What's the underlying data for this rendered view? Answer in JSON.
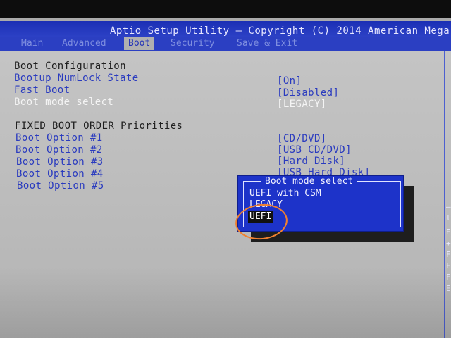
{
  "title": "Aptio Setup Utility – Copyright (C) 2014 American Mega",
  "tabs": [
    {
      "label": "Main"
    },
    {
      "label": "Advanced"
    },
    {
      "label": "Boot"
    },
    {
      "label": "Security"
    },
    {
      "label": "Save & Exit"
    }
  ],
  "boot_config": {
    "heading": "Boot Configuration",
    "items": [
      {
        "label": "Bootup NumLock State",
        "value": "[On]"
      },
      {
        "label": "Fast Boot",
        "value": "[Disabled]"
      },
      {
        "label": "Boot mode select",
        "value": "[LEGACY]"
      }
    ]
  },
  "boot_order": {
    "heading": "FIXED BOOT ORDER Priorities",
    "items": [
      {
        "label": "Boot Option #1",
        "value": "[CD/DVD]"
      },
      {
        "label": "Boot Option #2",
        "value": "[USB CD/DVD]"
      },
      {
        "label": "Boot Option #3",
        "value": "[Hard Disk]"
      },
      {
        "label": "Boot Option #4",
        "value": "[USB Hard Disk]"
      },
      {
        "label": "Boot Option #5",
        "value": ""
      }
    ]
  },
  "popup": {
    "title": "Boot mode select",
    "options": [
      {
        "label": "UEFI with CSM"
      },
      {
        "label": "LEGACY"
      },
      {
        "label": "UEFI"
      }
    ],
    "selected": "UEFI"
  },
  "help_chars": [
    "–",
    "l",
    "E",
    "+",
    "F",
    "F",
    "F",
    "E"
  ],
  "colors": {
    "title_blue": "#2f44c8",
    "panel_gray": "#c0c0c0",
    "item_blue": "#2a3bbf",
    "popup_blue": "#1d33c9",
    "annotation_orange": "#f08030"
  }
}
